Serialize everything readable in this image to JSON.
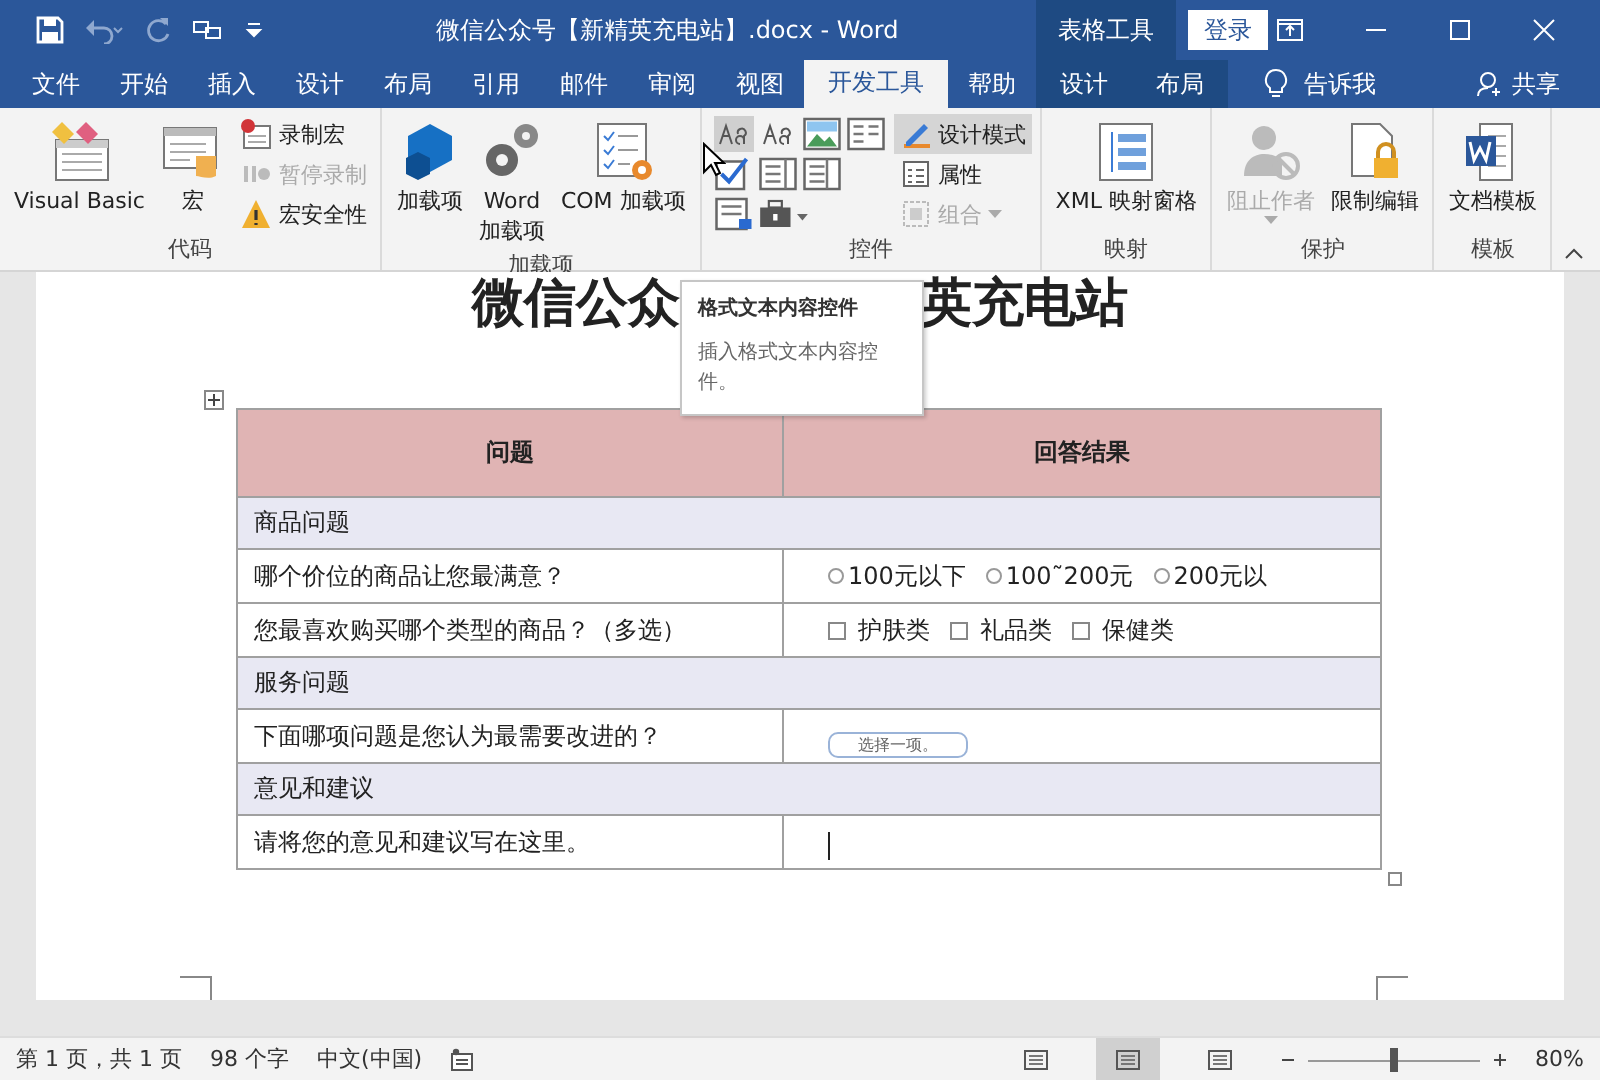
{
  "window": {
    "title": "微信公众号【新精英充电站】.docx  -  Word",
    "context_tab_group": "表格工具",
    "sign_in": "登录"
  },
  "tabs": [
    {
      "label": "文件",
      "selected": false,
      "contextual": false
    },
    {
      "label": "开始",
      "selected": false,
      "contextual": false
    },
    {
      "label": "插入",
      "selected": false,
      "contextual": false
    },
    {
      "label": "设计",
      "selected": false,
      "contextual": false
    },
    {
      "label": "布局",
      "selected": false,
      "contextual": false
    },
    {
      "label": "引用",
      "selected": false,
      "contextual": false
    },
    {
      "label": "邮件",
      "selected": false,
      "contextual": false
    },
    {
      "label": "审阅",
      "selected": false,
      "contextual": false
    },
    {
      "label": "视图",
      "selected": false,
      "contextual": false
    },
    {
      "label": "开发工具",
      "selected": true,
      "contextual": false
    },
    {
      "label": "帮助",
      "selected": false,
      "contextual": false
    },
    {
      "label": "设计",
      "selected": false,
      "contextual": true
    },
    {
      "label": "布局",
      "selected": false,
      "contextual": true
    }
  ],
  "tell_me": "告诉我",
  "share": "共享",
  "ribbon": [
    {
      "label": "代码",
      "columns": [
        [
          {
            "kind": "large",
            "label": "Visual Basic",
            "disabled": false
          }
        ],
        [
          {
            "kind": "large",
            "label": "宏",
            "disabled": false
          }
        ],
        [
          {
            "kind": "small",
            "label": "录制宏",
            "disabled": false
          },
          {
            "kind": "small",
            "label": "暂停录制",
            "disabled": true
          },
          {
            "kind": "small",
            "label": "宏安全性",
            "disabled": false
          }
        ]
      ]
    },
    {
      "label": "加载项",
      "columns": [
        [
          {
            "kind": "large",
            "label": "加载项",
            "disabled": false
          }
        ],
        [
          {
            "kind": "large",
            "label": "Word\n加载项",
            "disabled": false
          }
        ],
        [
          {
            "kind": "large",
            "label": "COM 加载项",
            "disabled": false
          }
        ]
      ]
    },
    {
      "label": "控件",
      "columns": [
        [
          {
            "kind": "icon-grid",
            "hovered": true
          }
        ],
        [
          {
            "kind": "small",
            "label": "设计模式",
            "disabled": false,
            "selected": true
          },
          {
            "kind": "small",
            "label": "属性",
            "disabled": false,
            "selected": false
          },
          {
            "kind": "small",
            "label": "组合",
            "disabled": true,
            "selected": false,
            "dropdown": true
          }
        ]
      ]
    },
    {
      "label": "映射",
      "columns": [
        [
          {
            "kind": "large",
            "label": "XML 映射窗格",
            "disabled": false
          }
        ]
      ]
    },
    {
      "label": "保护",
      "columns": [
        [
          {
            "kind": "large",
            "label": "阻止作者",
            "disabled": true,
            "dropdown": true
          }
        ],
        [
          {
            "kind": "large",
            "label": "限制编辑",
            "disabled": false
          }
        ]
      ]
    },
    {
      "label": "模板",
      "columns": [
        [
          {
            "kind": "large",
            "label": "文档模板",
            "disabled": false
          }
        ]
      ]
    }
  ],
  "document": {
    "heading_left": "微信公众",
    "heading_right": "英充电站",
    "table": {
      "columns": [
        "问题",
        "回答结果"
      ],
      "rows": [
        {
          "kind": "section",
          "label": "商品问题"
        },
        {
          "kind": "question",
          "label": "哪个价位的商品让您最满意？",
          "answer": {
            "kind": "radio",
            "options": [
              "100元以下",
              "100˜200元",
              "200元以"
            ]
          }
        },
        {
          "kind": "question",
          "label": "您最喜欢购买哪个类型的商品？（多选）",
          "answer": {
            "kind": "checkbox",
            "options": [
              "护肤类",
              "礼品类",
              "保健类"
            ]
          }
        },
        {
          "kind": "section",
          "label": "服务问题"
        },
        {
          "kind": "question",
          "label": "下面哪项问题是您认为最需要改进的？",
          "answer": {
            "kind": "dropdown",
            "placeholder": "选择一项。"
          }
        },
        {
          "kind": "section",
          "label": "意见和建议"
        },
        {
          "kind": "question",
          "label": "请将您的意见和建议写在这里。",
          "answer": {
            "kind": "text"
          }
        }
      ]
    }
  },
  "tooltip": {
    "title": "格式文本内容控件",
    "body": "插入格式文本内容控件。"
  },
  "status_bar": {
    "page": "第 1 页，共 1 页",
    "words": "98 个字",
    "language": "中文(中国)",
    "views": [
      {
        "selected": false
      },
      {
        "selected": true
      },
      {
        "selected": false
      }
    ],
    "zoom": {
      "level": 0.5,
      "reading": "80%"
    }
  }
}
